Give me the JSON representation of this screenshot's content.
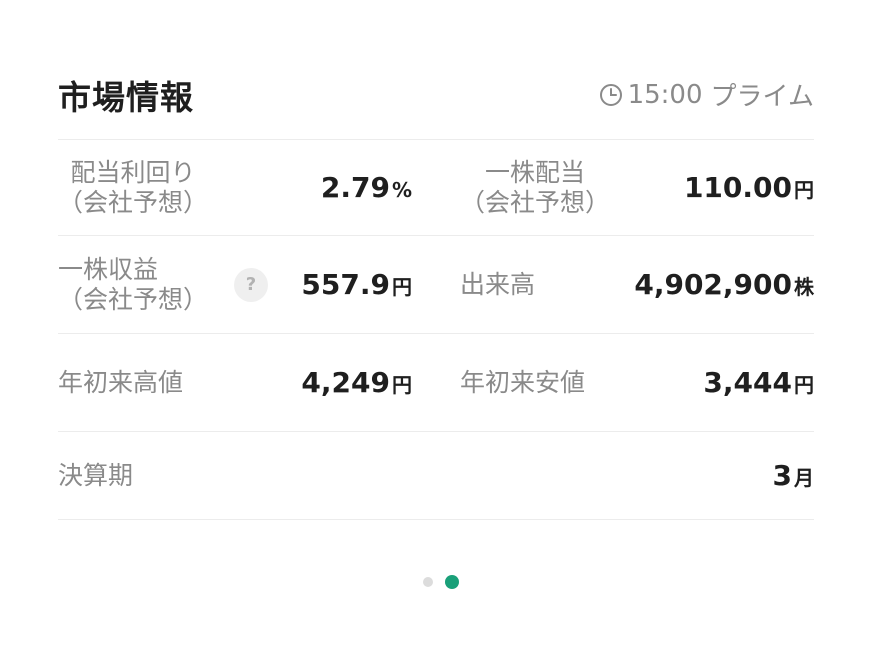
{
  "header": {
    "title": "市場情報",
    "time": "15:00",
    "market": "プライム"
  },
  "rows": {
    "dividend_yield": {
      "label_line1": "配当利回り",
      "label_line2": "（会社予想）",
      "value": "2.79",
      "unit": "%"
    },
    "dividend_per_share": {
      "label_line1": "一株配当",
      "label_line2": "（会社予想）",
      "value": "110.00",
      "unit": "円"
    },
    "eps": {
      "label_line1": "一株収益",
      "label_line2": "（会社予想）",
      "help": "?",
      "value": "557.9",
      "unit": "円"
    },
    "volume": {
      "label": "出来高",
      "value": "4,902,900",
      "unit": "株"
    },
    "ytd_high": {
      "label": "年初来高値",
      "value": "4,249",
      "unit": "円"
    },
    "ytd_low": {
      "label": "年初来安値",
      "value": "3,444",
      "unit": "円"
    },
    "fiscal_period": {
      "label": "決算期",
      "value": "3",
      "unit": "月"
    }
  },
  "pagination": {
    "total": 2,
    "active": 2,
    "active_color": "#1aa079",
    "inactive_color": "#dcdcdc"
  }
}
